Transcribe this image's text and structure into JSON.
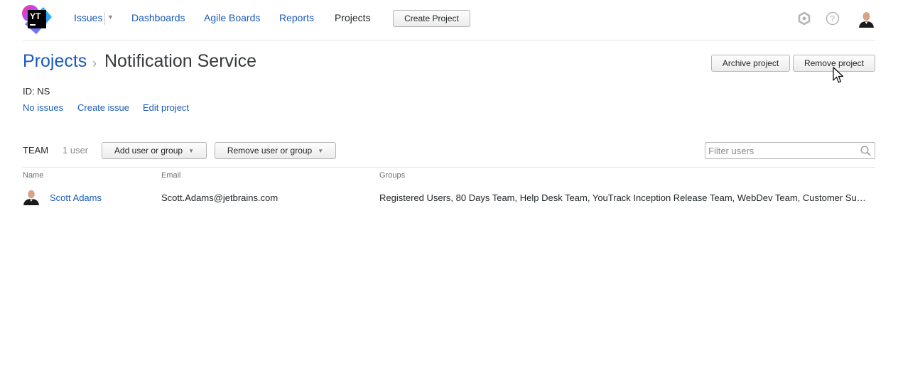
{
  "header": {
    "logo_text": "YT",
    "nav": {
      "issues": "Issues",
      "dashboards": "Dashboards",
      "agile_boards": "Agile Boards",
      "reports": "Reports",
      "projects": "Projects"
    },
    "create_project": "Create Project",
    "icons": [
      "settings-icon",
      "help-icon",
      "user-avatar"
    ]
  },
  "page": {
    "breadcrumb_root": "Projects",
    "breadcrumb_separator": "›",
    "title": "Notification Service",
    "project_id": "ID: NS",
    "links": {
      "no_issues": "No issues",
      "create_issue": "Create issue",
      "edit_project": "Edit project"
    },
    "actions": {
      "archive": "Archive project",
      "remove": "Remove project"
    }
  },
  "team": {
    "label": "TEAM",
    "count": "1 user",
    "add_button": "Add user or group",
    "remove_button": "Remove user or group",
    "filter_placeholder": "Filter users",
    "columns": {
      "name": "Name",
      "email": "Email",
      "groups": "Groups"
    },
    "rows": [
      {
        "name": "Scott Adams",
        "email": "Scott.Adams@jetbrains.com",
        "groups": "Registered Users, 80 Days Team, Help Desk Team, YouTrack Inception Release Team, WebDev Team, Customer Su…"
      }
    ]
  },
  "colors": {
    "link": "#1a5bb8",
    "text": "#1f2326",
    "muted": "#8a8a8a",
    "rule": "#e3e3e3"
  }
}
